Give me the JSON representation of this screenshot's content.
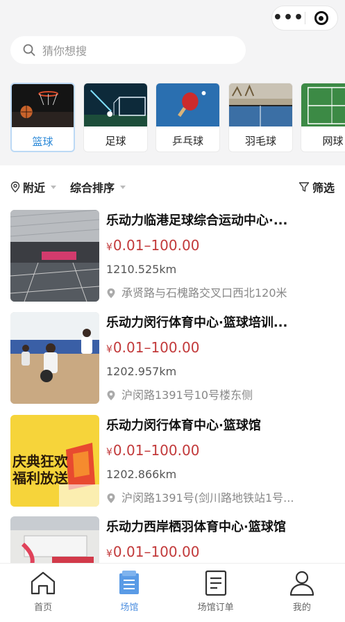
{
  "capsule": {
    "more_icon": "more-dots-icon",
    "close_icon": "target-close-icon"
  },
  "search": {
    "placeholder": "猜你想搜",
    "icon": "search-icon"
  },
  "categories": [
    {
      "label": "篮球",
      "active": true
    },
    {
      "label": "足球",
      "active": false
    },
    {
      "label": "乒乓球",
      "active": false
    },
    {
      "label": "羽毛球",
      "active": false
    },
    {
      "label": "网球",
      "active": false
    }
  ],
  "filters": {
    "nearby": "附近",
    "sort": "综合排序",
    "filter": "筛选"
  },
  "venues": [
    {
      "title": "乐动力临港足球综合运动中心·...",
      "price_symbol": "¥",
      "price": "0.01–100.00",
      "distance": "1210.525km",
      "address": "承贤路与石槐路交叉口西北120米"
    },
    {
      "title": "乐动力闵行体育中心·篮球培训...",
      "price_symbol": "¥",
      "price": "0.01–100.00",
      "distance": "1202.957km",
      "address": "沪闵路1391号10号楼东侧"
    },
    {
      "title": "乐动力闵行体育中心·篮球馆",
      "price_symbol": "¥",
      "price": "0.01–100.00",
      "distance": "1202.866km",
      "address": "沪闵路1391号(剑川路地铁站1号...",
      "image_text": "庆典狂欢 福利放送"
    },
    {
      "title": "乐动力西岸栖羽体育中心·篮球馆",
      "price_symbol": "¥",
      "price": "0.01–100.00",
      "distance": "",
      "address": ""
    }
  ],
  "tabbar": [
    {
      "label": "首页",
      "icon": "home-icon",
      "active": false
    },
    {
      "label": "场馆",
      "icon": "venue-icon",
      "active": true
    },
    {
      "label": "场馆订单",
      "icon": "order-icon",
      "active": false
    },
    {
      "label": "我的",
      "icon": "profile-icon",
      "active": false
    }
  ],
  "colors": {
    "accent": "#4e8fe0",
    "price": "#c2393a",
    "active_category": "#2b89d8"
  }
}
